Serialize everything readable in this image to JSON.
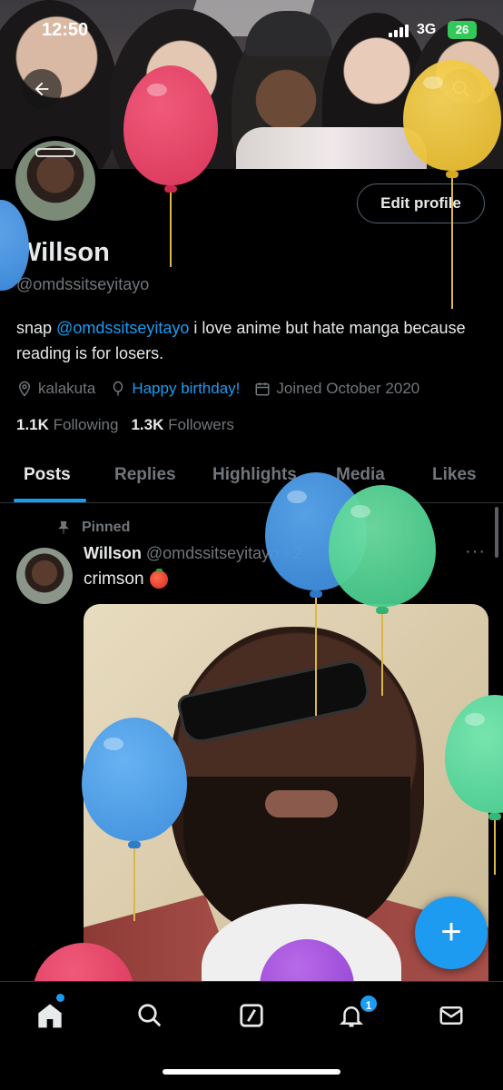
{
  "status_bar": {
    "time": "12:50",
    "network": "3G",
    "battery": "26"
  },
  "profile": {
    "name": "Willson",
    "handle": "@omdssitseyitayo",
    "edit_profile_label": "Edit profile",
    "bio_prefix": "snap ",
    "bio_mention": "@omdssitseyitayo",
    "bio_suffix": " i love anime but hate manga because reading is for losers.",
    "location": "kalakuta",
    "birthday": "Happy birthday!",
    "joined": "Joined October 2020",
    "following_count": "1.1K",
    "following_label": "Following",
    "followers_count": "1.3K",
    "followers_label": "Followers"
  },
  "tabs": [
    {
      "label": "Posts",
      "active": true
    },
    {
      "label": "Replies",
      "active": false
    },
    {
      "label": "Highlights",
      "active": false
    },
    {
      "label": "Media",
      "active": false
    },
    {
      "label": "Likes",
      "active": false
    }
  ],
  "post": {
    "pinned_label": "Pinned",
    "author_name": "Willson",
    "author_handle": "@omdssitseyitayo · 2",
    "text": "crimson",
    "more": "···"
  },
  "fab_label": "+",
  "nav": {
    "items": [
      "home-icon",
      "search-icon",
      "grok-icon",
      "bell-icon",
      "mail-icon"
    ],
    "notifications_badge": "1"
  },
  "colors": {
    "accent": "#1d9bf0",
    "background": "#000000",
    "text": "#e7e9ea",
    "muted": "#71767b"
  }
}
